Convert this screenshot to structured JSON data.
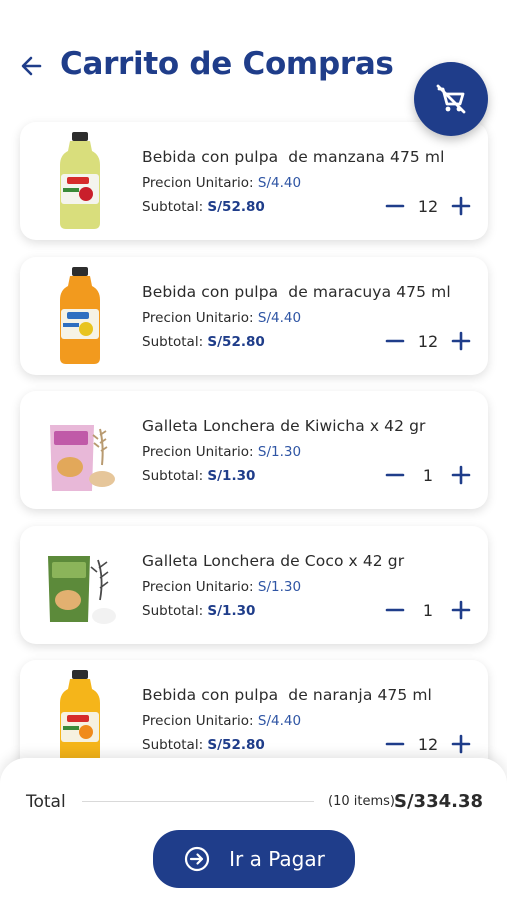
{
  "header": {
    "title": "Carrito de Compras",
    "back_icon": "arrow-left-icon",
    "clear_icon": "cart-off-icon"
  },
  "colors": {
    "primary": "#1f3d8a",
    "accent_text": "#2f55a4"
  },
  "labels": {
    "unit_price": "Precion Unitario: ",
    "subtotal": "Subtotal: "
  },
  "items": [
    {
      "name": "Bebida con pulpa  de manzana 475 ml",
      "unit_price": "S/4.40",
      "subtotal": "S/52.80",
      "qty": "12",
      "image": "bottle-apple-juice"
    },
    {
      "name": "Bebida con pulpa  de maracuya 475 ml",
      "unit_price": "S/4.40",
      "subtotal": "S/52.80",
      "qty": "12",
      "image": "bottle-passionfruit-juice"
    },
    {
      "name": "Galleta Lonchera de Kiwicha x 42 gr",
      "unit_price": "S/1.30",
      "subtotal": "S/1.30",
      "qty": "1",
      "image": "kiwicha-cookie-bag"
    },
    {
      "name": "Galleta Lonchera de Coco x 42 gr",
      "unit_price": "S/1.30",
      "subtotal": "S/1.30",
      "qty": "1",
      "image": "coconut-cookie-bag"
    },
    {
      "name": "Bebida con pulpa  de naranja 475 ml",
      "unit_price": "S/4.40",
      "subtotal": "S/52.80",
      "qty": "12",
      "image": "bottle-orange-juice"
    }
  ],
  "footer": {
    "total_label": "Total",
    "items_count": "(10 items)",
    "total_amount": "S/334.38",
    "pay_label": "Ir a Pagar",
    "pay_icon": "arrow-circle-right-icon"
  }
}
